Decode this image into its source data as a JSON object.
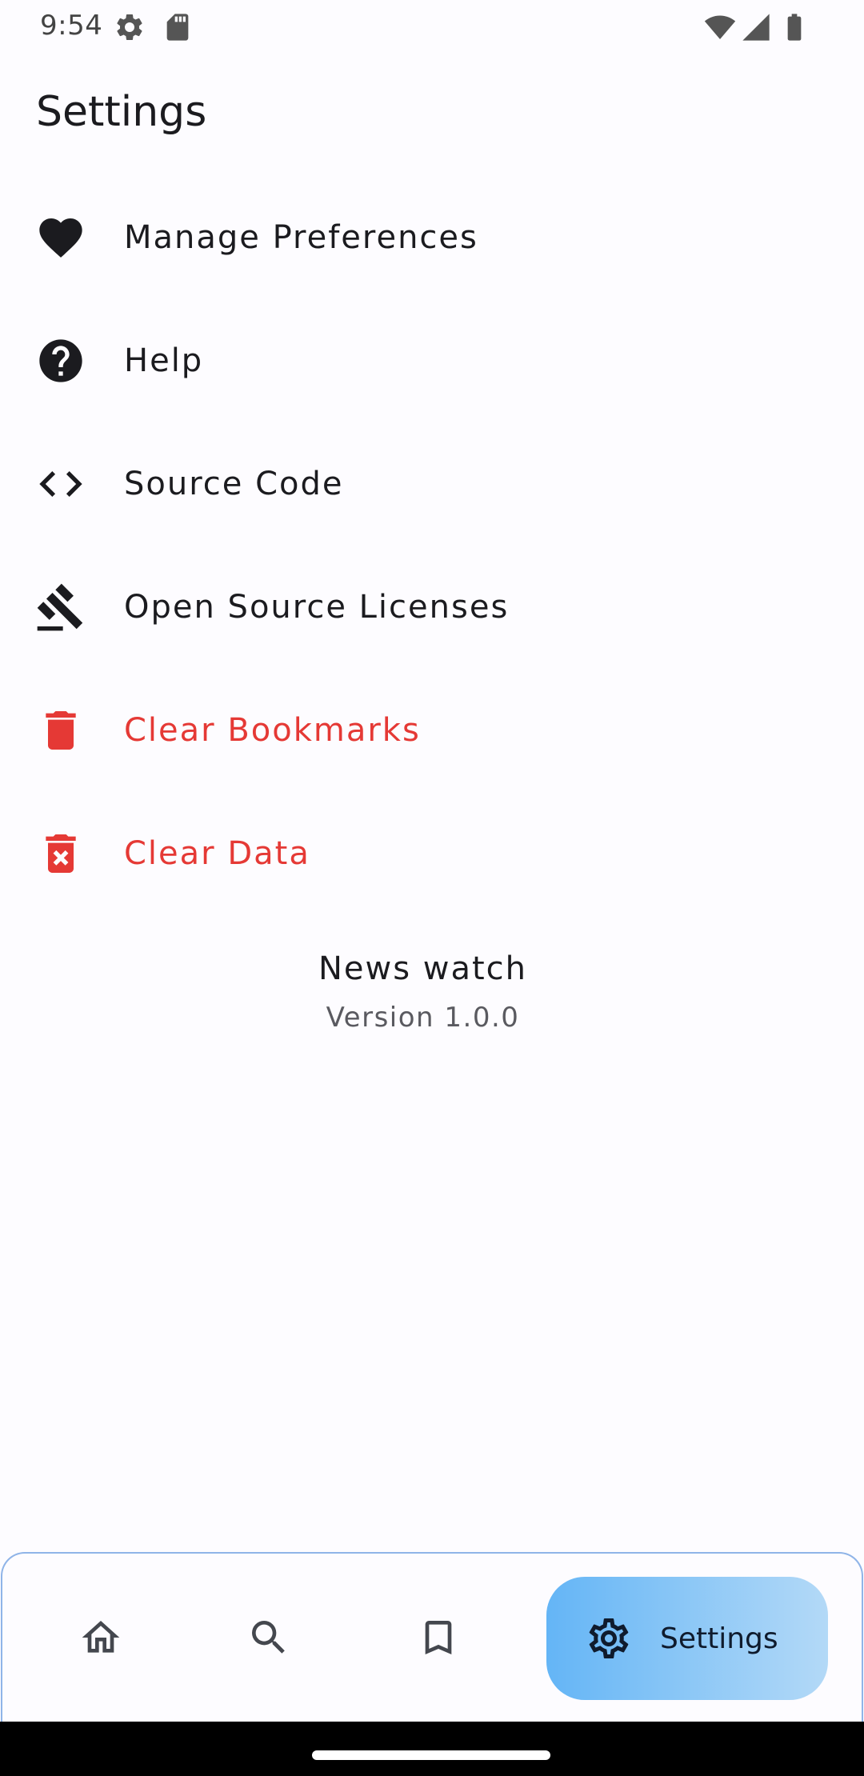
{
  "status_bar": {
    "time": "9:54",
    "icons": [
      "settings-gear-icon",
      "sd-card-icon",
      "wifi-icon",
      "signal-icon",
      "battery-icon"
    ]
  },
  "header": {
    "title": "Settings"
  },
  "settings": {
    "items": [
      {
        "label": "Manage Preferences",
        "icon": "heart-icon",
        "color": "#1b1b1f"
      },
      {
        "label": "Help",
        "icon": "help-circle-icon",
        "color": "#1b1b1f"
      },
      {
        "label": "Source Code",
        "icon": "code-icon",
        "color": "#1b1b1f"
      },
      {
        "label": "Open Source Licenses",
        "icon": "gavel-icon",
        "color": "#1b1b1f"
      },
      {
        "label": "Clear Bookmarks",
        "icon": "trash-icon",
        "color": "#e53935"
      },
      {
        "label": "Clear Data",
        "icon": "trash-x-icon",
        "color": "#e53935"
      }
    ]
  },
  "app_info": {
    "name": "News watch",
    "version": "Version 1.0.0"
  },
  "bottom_nav": {
    "items": [
      {
        "icon": "home-icon"
      },
      {
        "icon": "search-icon"
      },
      {
        "icon": "bookmark-icon"
      },
      {
        "icon": "settings-icon",
        "label": "Settings",
        "active": true
      }
    ]
  },
  "colors": {
    "danger": "#e53935",
    "accent_gradient_start": "#64b5f6",
    "accent_gradient_end": "#b3d9f7"
  }
}
